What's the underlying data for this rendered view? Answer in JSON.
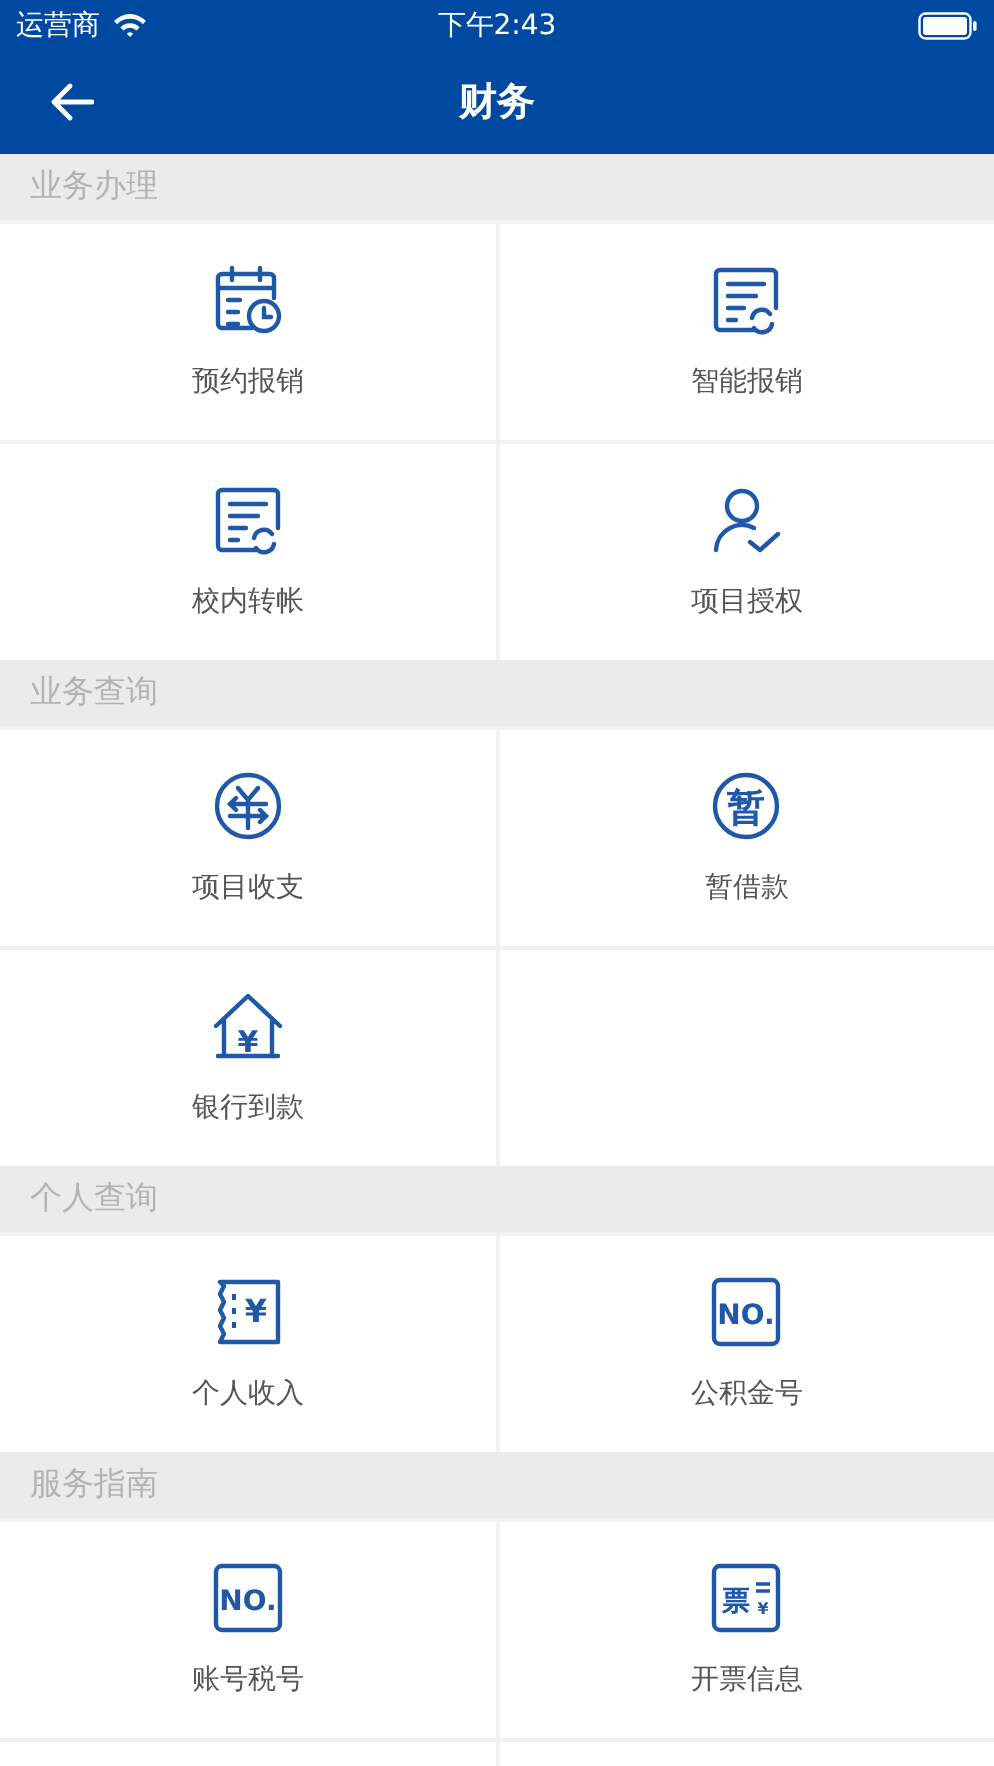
{
  "status_bar": {
    "carrier": "运营商",
    "time": "下午2:43"
  },
  "nav_bar": {
    "title": "财务"
  },
  "sections": [
    {
      "title": "业务办理",
      "items": [
        {
          "label": "预约报销",
          "kind": "calendar-clock"
        },
        {
          "label": "智能报销",
          "kind": "document-refresh"
        },
        {
          "label": "校内转帐",
          "kind": "document-refresh"
        },
        {
          "label": "项目授权",
          "kind": "person-check"
        }
      ]
    },
    {
      "title": "业务查询",
      "items": [
        {
          "label": "项目收支",
          "kind": "exchange-circle"
        },
        {
          "label": "暂借款",
          "kind": "glyph-circle",
          "glyphs": [
            "暂"
          ]
        },
        {
          "label": "银行到款",
          "kind": "house-glyph",
          "glyphs": [
            "¥"
          ]
        }
      ]
    },
    {
      "title": "个人查询",
      "items": [
        {
          "label": "个人收入",
          "kind": "receipt-glyph",
          "glyphs": [
            "¥"
          ]
        },
        {
          "label": "公积金号",
          "kind": "glyph-square",
          "glyphs": [
            "NO."
          ]
        }
      ]
    },
    {
      "title": "服务指南",
      "items": [
        {
          "label": "账号税号",
          "kind": "glyph-square",
          "glyphs": [
            "NO."
          ]
        },
        {
          "label": "开票信息",
          "kind": "invoice-glyph",
          "glyphs": [
            "票",
            "¥"
          ]
        }
      ]
    }
  ]
}
